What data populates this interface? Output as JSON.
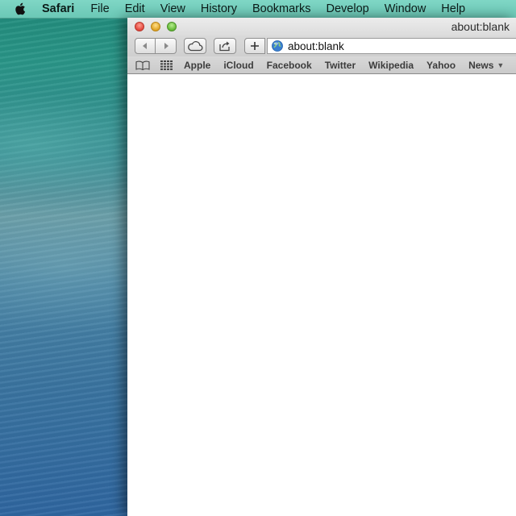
{
  "menubar": {
    "app_name": "Safari",
    "items": [
      "File",
      "Edit",
      "View",
      "History",
      "Bookmarks",
      "Develop",
      "Window",
      "Help"
    ]
  },
  "window": {
    "title": "about:blank",
    "address": "about:blank"
  },
  "bookmarks_bar": {
    "items": [
      "Apple",
      "iCloud",
      "Facebook",
      "Twitter",
      "Wikipedia",
      "Yahoo"
    ],
    "menu_item": "News"
  },
  "icons": {
    "apple_menu": "apple-logo-icon",
    "back": "back-arrow-icon",
    "forward": "forward-arrow-icon",
    "icloud_tabs": "cloud-icon",
    "share": "share-icon",
    "new_tab": "plus-icon",
    "site": "globe-icon",
    "reading_list": "book-icon",
    "top_sites": "grid-icon",
    "news_dropdown": "triangle-down-icon"
  },
  "colors": {
    "menubar": "#7fd6c5",
    "close_light": "#e2463c",
    "minimize_light": "#e0a324",
    "zoom_light": "#63b936"
  }
}
